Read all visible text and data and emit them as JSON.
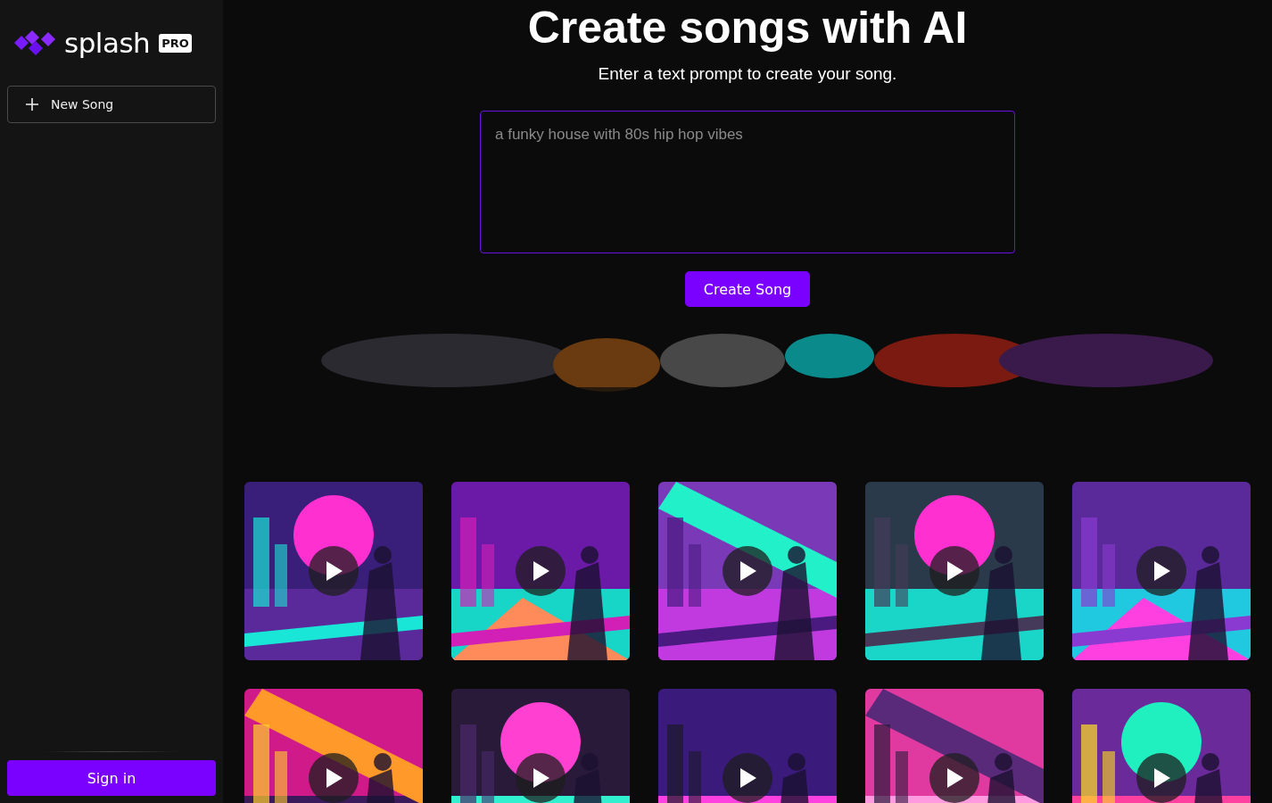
{
  "sidebar": {
    "logo": {
      "name": "splash",
      "badge": "PRO"
    },
    "new_song_button": {
      "label": "New Song"
    },
    "sign_in_button": {
      "label": "Sign in"
    }
  },
  "hero": {
    "title": "Create songs with AI",
    "subtitle": "Enter a text prompt to create your song.",
    "prompt": {
      "placeholder": "a funky house with 80s hip hop vibes"
    },
    "create_button": {
      "label": "Create Song"
    }
  }
}
